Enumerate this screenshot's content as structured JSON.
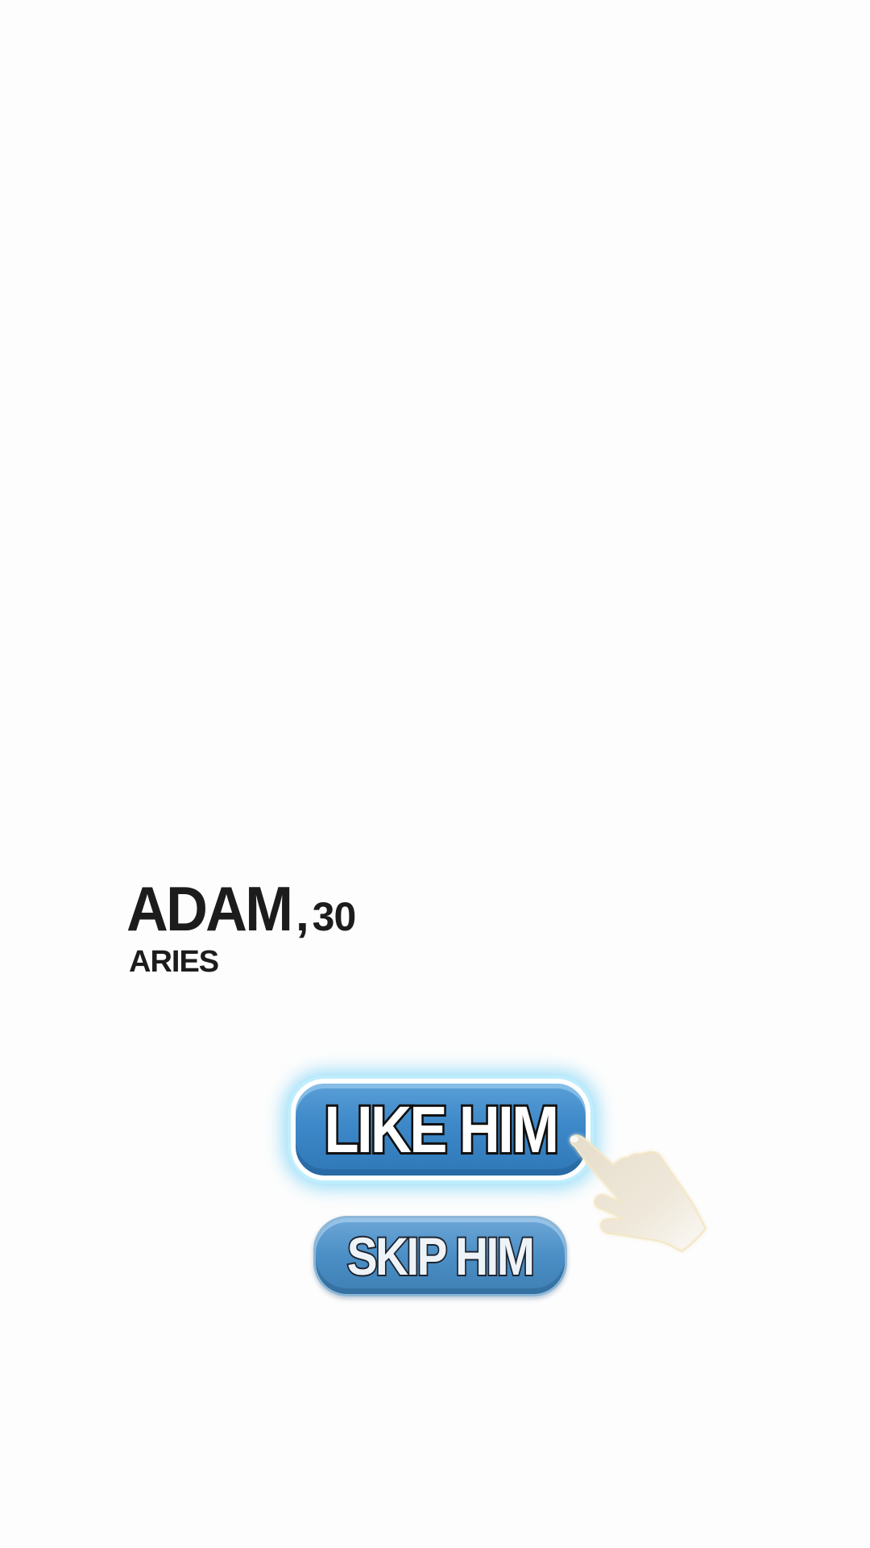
{
  "profile": {
    "name": "ADAM",
    "separator": ",",
    "age": "30",
    "sign": "ARIES"
  },
  "actions": {
    "like_label": "LIKE HIM",
    "skip_label": "SKIP HIM"
  },
  "tutorial": {
    "pointer_icon": "pointing-hand-icon"
  },
  "colors": {
    "button_blue": "#3d88c8",
    "glow_cyan": "#bfeefd",
    "text_dark": "#1c1c1c",
    "hand_skin": "#ece3d3"
  }
}
